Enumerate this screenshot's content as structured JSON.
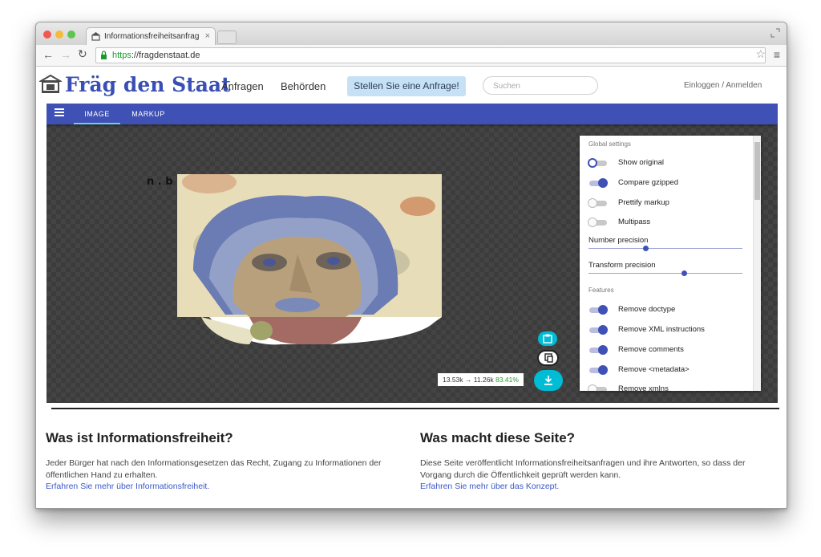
{
  "browser": {
    "tab_title": "Informationsfreiheitsanfrag",
    "tab_close": "×",
    "url_scheme": "https",
    "url_rest": "://fragdenstaat.de"
  },
  "site": {
    "brand": "Fräg den Staat",
    "nav": [
      "Anfragen",
      "Behörden"
    ],
    "cta": "Stellen Sie eine Anfrage!",
    "search_placeholder": "Suchen",
    "login": "Einloggen / Anmelden"
  },
  "app": {
    "tabs": [
      "IMAGE",
      "MARKUP"
    ],
    "active_tab": "IMAGE",
    "global_settings_label": "Global settings",
    "features_label": "Features",
    "global_toggles": [
      {
        "label": "Show original",
        "state": "off-focused"
      },
      {
        "label": "Compare gzipped",
        "state": "on"
      },
      {
        "label": "Prettify markup",
        "state": "off"
      },
      {
        "label": "Multipass",
        "state": "off"
      }
    ],
    "sliders": [
      {
        "label": "Number precision",
        "value_fraction": 0.37
      },
      {
        "label": "Transform precision",
        "value_fraction": 0.63
      }
    ],
    "feature_toggles": [
      {
        "label": "Remove doctype",
        "state": "on"
      },
      {
        "label": "Remove XML instructions",
        "state": "on"
      },
      {
        "label": "Remove comments",
        "state": "on"
      },
      {
        "label": "Remove <metadata>",
        "state": "on"
      },
      {
        "label": "Remove xmlns",
        "state": "off"
      }
    ],
    "stats": {
      "before": "13.53k",
      "arrow": "→",
      "after": "11.26k",
      "percent": "83.41%"
    },
    "scribble_text": "n . b",
    "colors": {
      "app_bar": "#3f51b5",
      "accent": "#00bcd4"
    }
  },
  "info": {
    "left": {
      "title": "Was ist Informationsfreiheit?",
      "text": "Jeder Bürger hat nach den Informationsgesetzen das Recht, Zugang zu Informationen der öffentlichen Hand zu erhalten.",
      "link": "Erfahren Sie mehr über Informationsfreiheit."
    },
    "right": {
      "title": "Was macht diese Seite?",
      "text": "Diese Seite veröffentlicht Informationsfreiheitsanfragen und ihre Antworten, so dass der Vorgang durch die Öffentlichkeit geprüft werden kann.",
      "link": "Erfahren Sie mehr über das Konzept."
    }
  }
}
